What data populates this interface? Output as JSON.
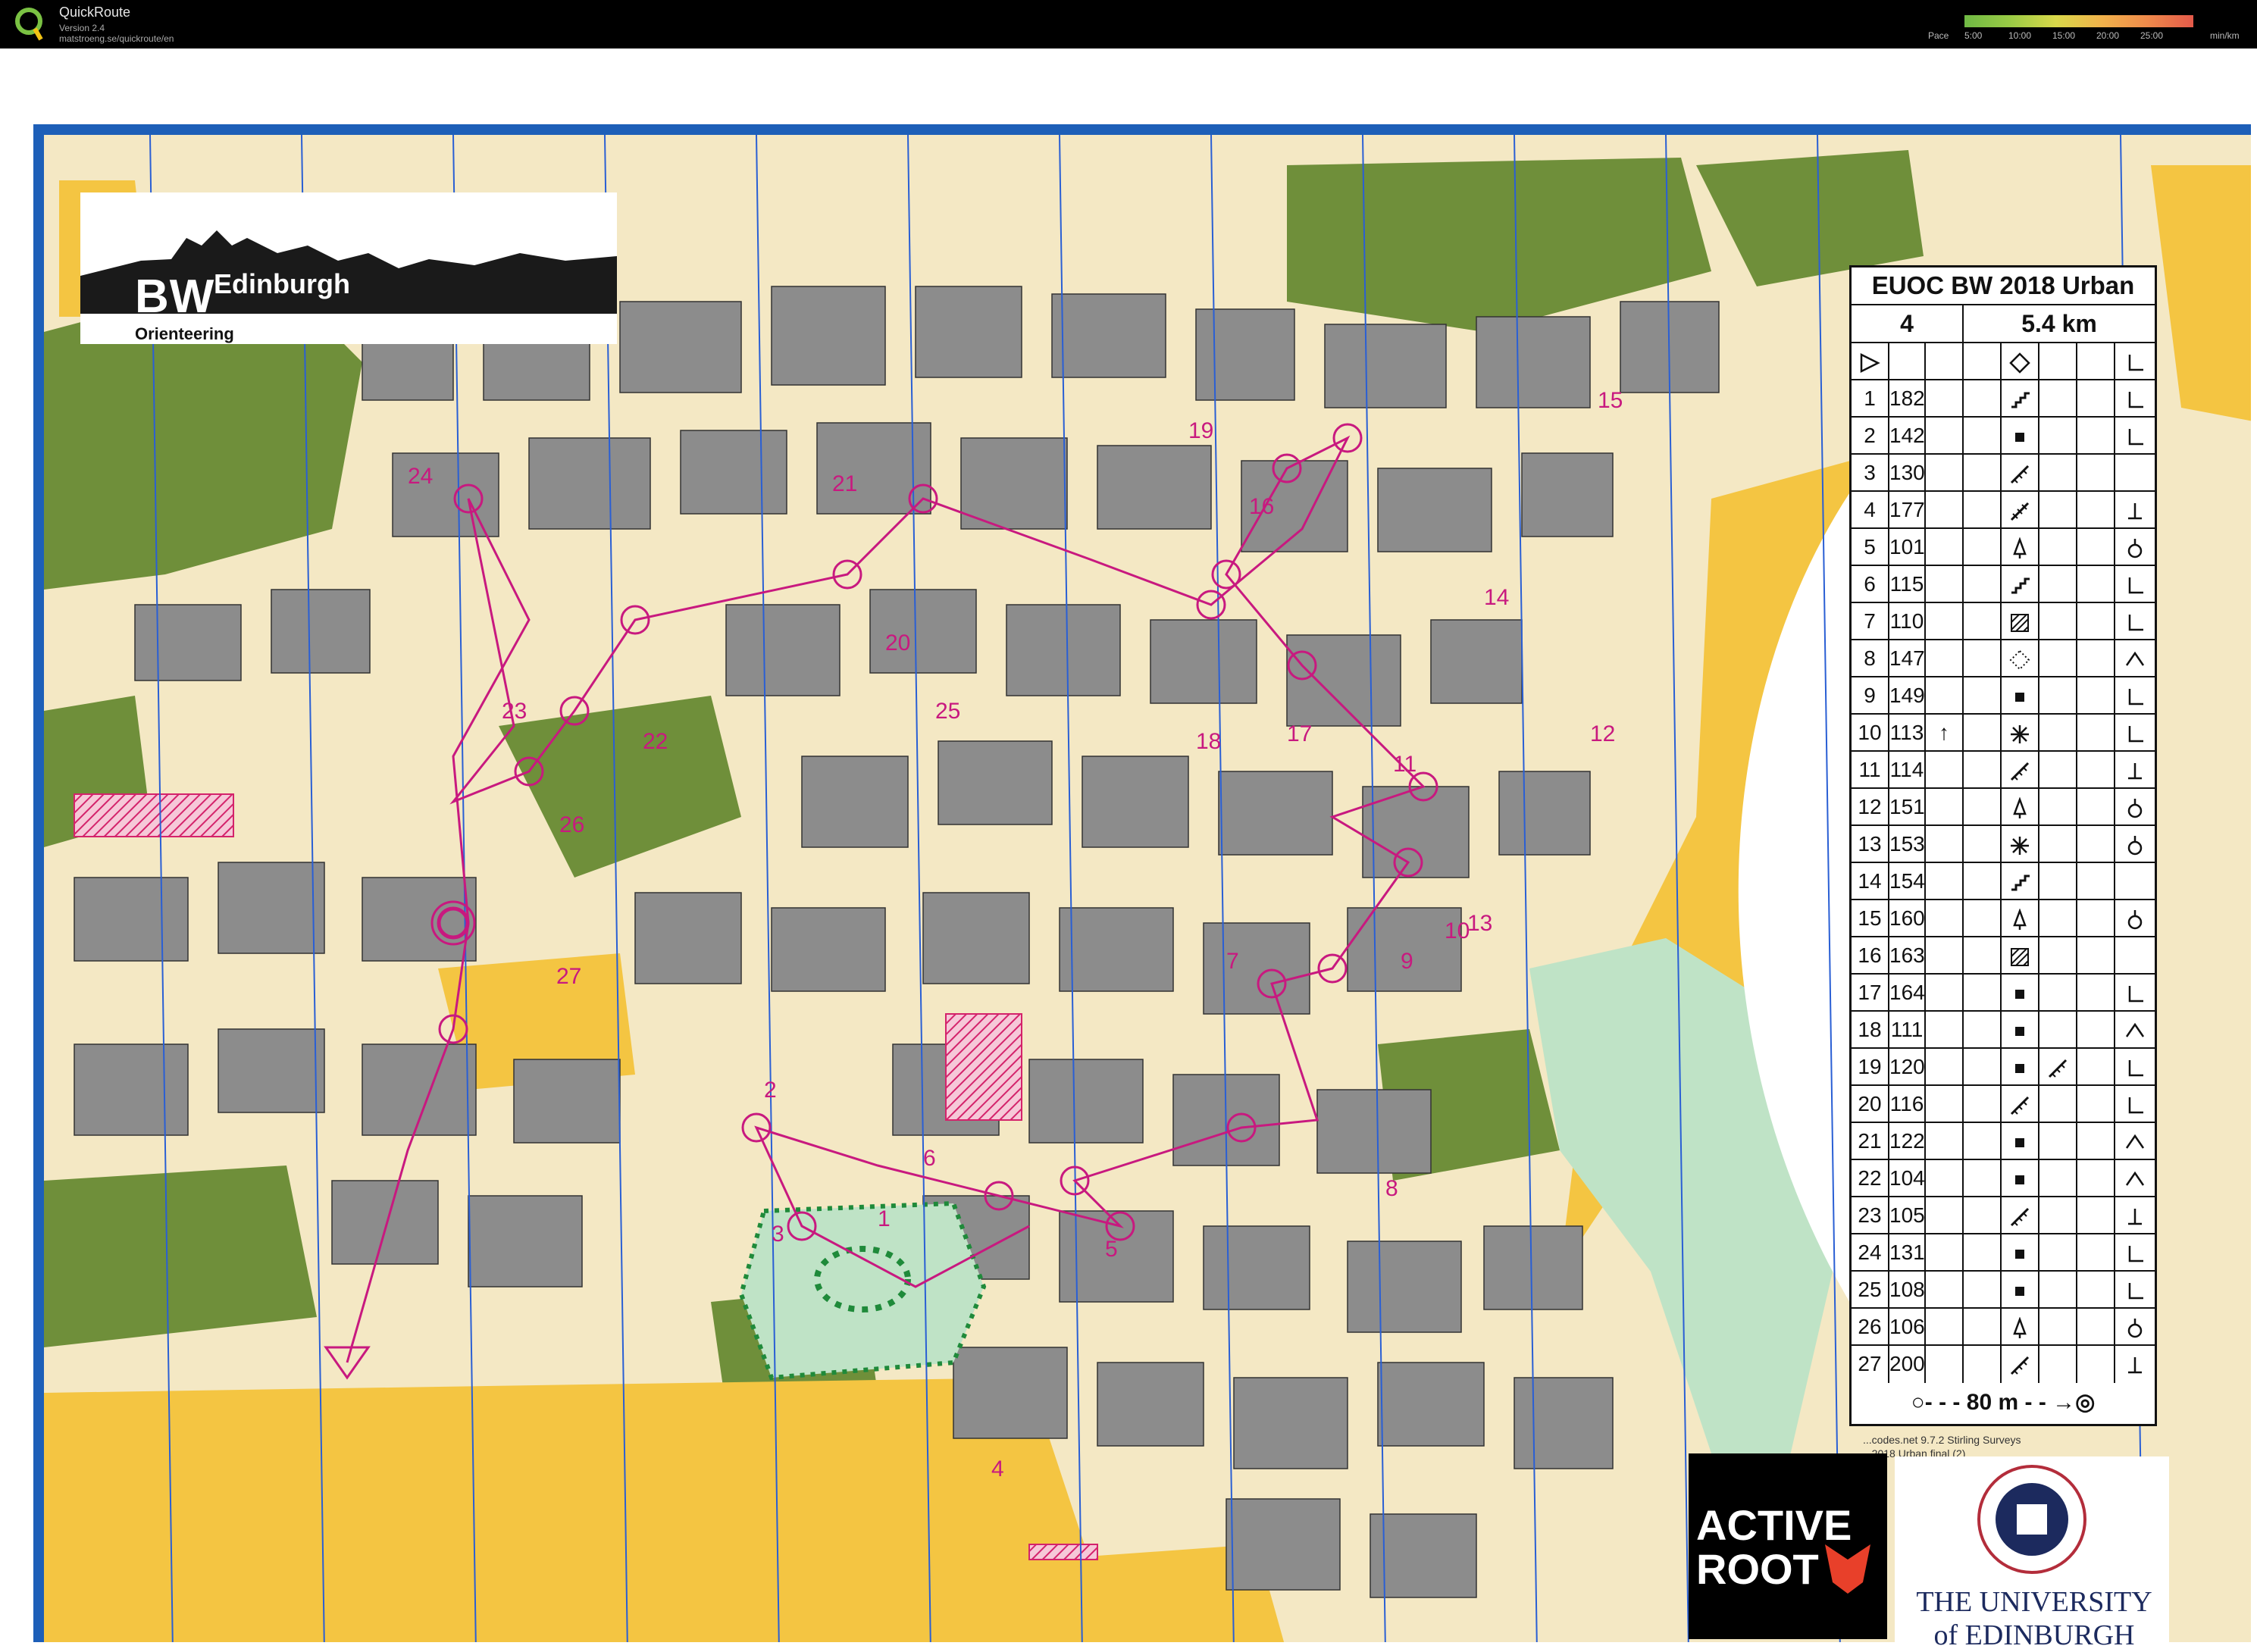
{
  "titlebar": {
    "app_name": "QuickRoute",
    "version": "Version 2.4",
    "url": "matstroeng.se/quickroute/en",
    "pace_label": "Pace",
    "pace_ticks": [
      "5:00",
      "10:00",
      "15:00",
      "20:00",
      "25:00"
    ],
    "pace_unit": "min/km"
  },
  "map": {
    "club_logo": {
      "initials": "BW",
      "city": "Edinburgh",
      "subtitle": "Orienteering"
    },
    "control_numbers": [
      "1",
      "2",
      "3",
      "4",
      "5",
      "6",
      "7",
      "8",
      "9",
      "10",
      "11",
      "12",
      "13",
      "14",
      "15",
      "16",
      "17",
      "18",
      "19",
      "20",
      "21",
      "22",
      "23",
      "24",
      "25",
      "26",
      "27"
    ],
    "credit_line_1": "...codes.net 9.7.2 Stirling Surveys",
    "credit_line_2": "...2018 Urban final (2)",
    "sponsor_1": "ACTIVE ROOT",
    "sponsor_2": "THE UNIVERSITY of EDINBURGH",
    "colors": {
      "frame": "#1d5fb8",
      "course": "#c8197f",
      "building": "#8c8c8c",
      "vegetation": "#6f8f3a",
      "open_land": "#f4c542",
      "paved": "#f4e8c4"
    }
  },
  "control_descriptions": {
    "title": "EUOC BW 2018 Urban",
    "course": "4",
    "length": "5.4 km",
    "start_symbol": "triangle-icon",
    "rows": [
      {
        "num": "1",
        "code": "182",
        "feature": "stairway-icon",
        "detail": "corner-icon"
      },
      {
        "num": "2",
        "code": "142",
        "feature": "building-icon",
        "detail": "corner-icon"
      },
      {
        "num": "3",
        "code": "130",
        "feature": "wall-icon",
        "detail": ""
      },
      {
        "num": "4",
        "code": "177",
        "feature": "fence-icon",
        "detail": "foot-icon"
      },
      {
        "num": "5",
        "code": "101",
        "feature": "tree-icon",
        "detail": "circle-foot-icon"
      },
      {
        "num": "6",
        "code": "115",
        "feature": "stairway-icon",
        "detail": "corner-icon"
      },
      {
        "num": "7",
        "code": "110",
        "feature": "hatched-area-icon",
        "detail": "corner-icon"
      },
      {
        "num": "8",
        "code": "147",
        "feature": "dotted-area-icon",
        "detail": "caret-icon"
      },
      {
        "num": "9",
        "code": "149",
        "feature": "building-icon",
        "detail": "corner-icon"
      },
      {
        "num": "10",
        "code": "113",
        "feature": "thicket-icon",
        "detail": "corner-icon",
        "direction": "↑"
      },
      {
        "num": "11",
        "code": "114",
        "feature": "wall-icon",
        "detail": "foot-icon"
      },
      {
        "num": "12",
        "code": "151",
        "feature": "tree-icon",
        "detail": "circle-foot-icon"
      },
      {
        "num": "13",
        "code": "153",
        "feature": "thicket-icon",
        "detail": "circle-foot-icon"
      },
      {
        "num": "14",
        "code": "154",
        "feature": "stairway-icon",
        "detail": ""
      },
      {
        "num": "15",
        "code": "160",
        "feature": "tree-icon",
        "detail": "circle-foot-icon"
      },
      {
        "num": "16",
        "code": "163",
        "feature": "hatched-area-icon",
        "detail": ""
      },
      {
        "num": "17",
        "code": "164",
        "feature": "building-icon",
        "detail": "corner-icon"
      },
      {
        "num": "18",
        "code": "111",
        "feature": "building-icon",
        "detail": "caret-icon"
      },
      {
        "num": "19",
        "code": "120",
        "feature": "building-icon",
        "detail": "corner-icon",
        "extra": "wall-icon"
      },
      {
        "num": "20",
        "code": "116",
        "feature": "wall-icon",
        "detail": "corner-icon"
      },
      {
        "num": "21",
        "code": "122",
        "feature": "building-icon",
        "detail": "caret-icon"
      },
      {
        "num": "22",
        "code": "104",
        "feature": "building-icon",
        "detail": "caret-icon"
      },
      {
        "num": "23",
        "code": "105",
        "feature": "wall-icon",
        "detail": "foot-icon"
      },
      {
        "num": "24",
        "code": "131",
        "feature": "building-icon",
        "detail": "corner-icon"
      },
      {
        "num": "25",
        "code": "108",
        "feature": "building-icon",
        "detail": "corner-icon"
      },
      {
        "num": "26",
        "code": "106",
        "feature": "tree-icon",
        "detail": "circle-foot-icon"
      },
      {
        "num": "27",
        "code": "200",
        "feature": "wall-icon",
        "detail": "foot-icon"
      }
    ],
    "finish": "80 m"
  }
}
